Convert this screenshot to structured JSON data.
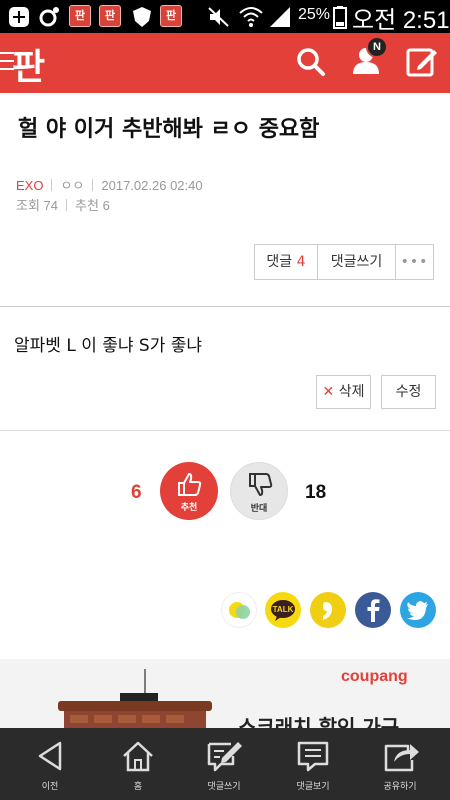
{
  "status_bar": {
    "battery_pct": "25%",
    "time": "오전 2:51",
    "app_icon_label": "판"
  },
  "header": {
    "logo": "판",
    "icons": [
      "menu-icon",
      "search-icon",
      "user-icon",
      "edit-icon"
    ],
    "notification_badge": "N"
  },
  "post": {
    "title": "헐 야 이거 추반해봐 ㄹㅇ 중요함",
    "category": "EXO",
    "author": "ㅇㅇ",
    "date": "2017.02.26 02:40",
    "views_label": "조회",
    "views": "74",
    "recommend_label": "추천",
    "recommends": "6",
    "reply_label": "댓글",
    "reply_count": "4",
    "write_reply_label": "댓글쓰기",
    "more_label": "•••"
  },
  "comment": {
    "text": "알파벳 L 이 좋냐 S가 좋냐",
    "delete_label": "삭제",
    "edit_label": "수정"
  },
  "votes": {
    "up_count": "6",
    "up_label": "추천",
    "down_label": "반대",
    "down_count": "18"
  },
  "share": [
    "kakaostory-icon",
    "kakaotalk-icon",
    "band-icon",
    "facebook-icon",
    "twitter-icon"
  ],
  "share_talk_label": "TALK",
  "ad": {
    "brand": "coupang",
    "text": "스크래치 할인 가구"
  },
  "bottom_nav": [
    {
      "label": "이전",
      "icon": "back-icon"
    },
    {
      "label": "홈",
      "icon": "home-icon"
    },
    {
      "label": "댓글쓰기",
      "icon": "write-comment-icon"
    },
    {
      "label": "댓글보기",
      "icon": "view-comments-icon"
    },
    {
      "label": "공유하기",
      "icon": "share-icon"
    }
  ],
  "colors": {
    "brand_red": "#e3403a",
    "status_bar": "#000000",
    "nav_bar": "#2b2b2b"
  }
}
